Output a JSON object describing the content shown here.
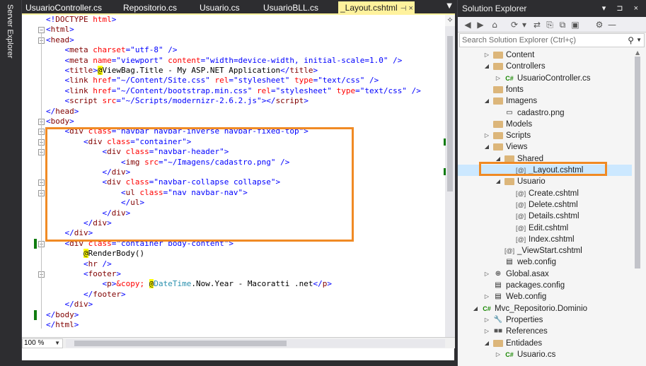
{
  "left_panel": {
    "server_explorer_label": "Server Explorer"
  },
  "editor": {
    "tabs": [
      {
        "label": "UsuarioController.cs",
        "active": false
      },
      {
        "label": "Repositorio.cs",
        "active": false
      },
      {
        "label": "Usuario.cs",
        "active": false
      },
      {
        "label": "UsuarioBLL.cs",
        "active": false
      },
      {
        "label": "_Layout.cshtml",
        "active": true
      }
    ],
    "pin_glyph": "⊣",
    "close_glyph": "×",
    "overflow_glyph": "▼",
    "split_glyph": "⟡",
    "zoom": "100 %",
    "zoom_dd_glyph": "▼"
  },
  "code_lines": [
    [
      [
        "t-br",
        "<!"
      ],
      [
        "t-tag",
        "DOCTYPE"
      ],
      [
        "t-br",
        " "
      ],
      [
        "t-attr",
        "html"
      ],
      [
        "t-br",
        ">"
      ]
    ],
    [
      [
        "t-br",
        "<"
      ],
      [
        "t-tag",
        "html"
      ],
      [
        "t-br",
        ">"
      ]
    ],
    [
      [
        "t-br",
        "<"
      ],
      [
        "t-tag",
        "head"
      ],
      [
        "t-br",
        ">"
      ]
    ],
    [
      [
        "t-txt",
        "    "
      ],
      [
        "t-br",
        "<"
      ],
      [
        "t-tag",
        "meta"
      ],
      [
        "t-br",
        " "
      ],
      [
        "t-attr",
        "charset"
      ],
      [
        "t-br",
        "="
      ],
      [
        "t-val",
        "\"utf-8\""
      ],
      [
        "t-br",
        " />"
      ]
    ],
    [
      [
        "t-txt",
        "    "
      ],
      [
        "t-br",
        "<"
      ],
      [
        "t-tag",
        "meta"
      ],
      [
        "t-br",
        " "
      ],
      [
        "t-attr",
        "name"
      ],
      [
        "t-br",
        "="
      ],
      [
        "t-val",
        "\"viewport\""
      ],
      [
        "t-br",
        " "
      ],
      [
        "t-attr",
        "content"
      ],
      [
        "t-br",
        "="
      ],
      [
        "t-val",
        "\"width=device-width, initial-scale=1.0\""
      ],
      [
        "t-br",
        " />"
      ]
    ],
    [
      [
        "t-txt",
        "    "
      ],
      [
        "t-br",
        "<"
      ],
      [
        "t-tag",
        "title"
      ],
      [
        "t-br",
        ">"
      ],
      [
        "t-razor",
        "@"
      ],
      [
        "t-txt",
        "ViewBag.Title - My ASP.NET Application"
      ],
      [
        "t-br",
        "</"
      ],
      [
        "t-tag",
        "title"
      ],
      [
        "t-br",
        ">"
      ]
    ],
    [
      [
        "t-txt",
        "    "
      ],
      [
        "t-br",
        "<"
      ],
      [
        "t-tag",
        "link"
      ],
      [
        "t-br",
        " "
      ],
      [
        "t-attr",
        "href"
      ],
      [
        "t-br",
        "="
      ],
      [
        "t-val",
        "\"~/Content/Site.css\""
      ],
      [
        "t-br",
        " "
      ],
      [
        "t-attr",
        "rel"
      ],
      [
        "t-br",
        "="
      ],
      [
        "t-val",
        "\"stylesheet\""
      ],
      [
        "t-br",
        " "
      ],
      [
        "t-attr",
        "type"
      ],
      [
        "t-br",
        "="
      ],
      [
        "t-val",
        "\"text/css\""
      ],
      [
        "t-br",
        " />"
      ]
    ],
    [
      [
        "t-txt",
        "    "
      ],
      [
        "t-br",
        "<"
      ],
      [
        "t-tag",
        "link"
      ],
      [
        "t-br",
        " "
      ],
      [
        "t-attr",
        "href"
      ],
      [
        "t-br",
        "="
      ],
      [
        "t-val",
        "\"~/Content/bootstrap.min.css\""
      ],
      [
        "t-br",
        " "
      ],
      [
        "t-attr",
        "rel"
      ],
      [
        "t-br",
        "="
      ],
      [
        "t-val",
        "\"stylesheet\""
      ],
      [
        "t-br",
        " "
      ],
      [
        "t-attr",
        "type"
      ],
      [
        "t-br",
        "="
      ],
      [
        "t-val",
        "\"text/css\""
      ],
      [
        "t-br",
        " />"
      ]
    ],
    [
      [
        "t-txt",
        "    "
      ],
      [
        "t-br",
        "<"
      ],
      [
        "t-tag",
        "script"
      ],
      [
        "t-br",
        " "
      ],
      [
        "t-attr",
        "src"
      ],
      [
        "t-br",
        "="
      ],
      [
        "t-val",
        "\"~/Scripts/modernizr-2.6.2.js\""
      ],
      [
        "t-br",
        "></"
      ],
      [
        "t-tag",
        "script"
      ],
      [
        "t-br",
        ">"
      ]
    ],
    [
      [
        "t-br",
        "</"
      ],
      [
        "t-tag",
        "head"
      ],
      [
        "t-br",
        ">"
      ]
    ],
    [
      [
        "t-br",
        "<"
      ],
      [
        "t-tag",
        "body"
      ],
      [
        "t-br",
        ">"
      ]
    ],
    [
      [
        "t-txt",
        "    "
      ],
      [
        "t-br",
        "<"
      ],
      [
        "t-tag",
        "div"
      ],
      [
        "t-br",
        " "
      ],
      [
        "t-attr",
        "class"
      ],
      [
        "t-br",
        "="
      ],
      [
        "t-val",
        "\"navbar navbar-inverse navbar-fixed-top\""
      ],
      [
        "t-br",
        ">"
      ]
    ],
    [
      [
        "t-txt",
        "        "
      ],
      [
        "t-br",
        "<"
      ],
      [
        "t-tag",
        "div"
      ],
      [
        "t-br",
        " "
      ],
      [
        "t-attr",
        "class"
      ],
      [
        "t-br",
        "="
      ],
      [
        "t-val",
        "\"container\""
      ],
      [
        "t-br",
        ">"
      ]
    ],
    [
      [
        "t-txt",
        "            "
      ],
      [
        "t-br",
        "<"
      ],
      [
        "t-tag",
        "div"
      ],
      [
        "t-br",
        " "
      ],
      [
        "t-attr",
        "class"
      ],
      [
        "t-br",
        "="
      ],
      [
        "t-val",
        "\"navbar-header\""
      ],
      [
        "t-br",
        ">"
      ]
    ],
    [
      [
        "t-txt",
        "                "
      ],
      [
        "t-br",
        "<"
      ],
      [
        "t-tag",
        "img"
      ],
      [
        "t-br",
        " "
      ],
      [
        "t-attr",
        "src"
      ],
      [
        "t-br",
        "="
      ],
      [
        "t-val",
        "\"~/Imagens/cadastro.png\""
      ],
      [
        "t-br",
        " />"
      ]
    ],
    [
      [
        "t-txt",
        "            "
      ],
      [
        "t-br",
        "</"
      ],
      [
        "t-tag",
        "div"
      ],
      [
        "t-br",
        ">"
      ]
    ],
    [
      [
        "t-txt",
        "            "
      ],
      [
        "t-br",
        "<"
      ],
      [
        "t-tag",
        "div"
      ],
      [
        "t-br",
        " "
      ],
      [
        "t-attr",
        "class"
      ],
      [
        "t-br",
        "="
      ],
      [
        "t-val",
        "\"navbar-collapse collapse\""
      ],
      [
        "t-br",
        ">"
      ]
    ],
    [
      [
        "t-txt",
        "                "
      ],
      [
        "t-br",
        "<"
      ],
      [
        "t-tag",
        "ul"
      ],
      [
        "t-br",
        " "
      ],
      [
        "t-attr",
        "class"
      ],
      [
        "t-br",
        "="
      ],
      [
        "t-val",
        "\"nav navbar-nav\""
      ],
      [
        "t-br",
        ">"
      ]
    ],
    [
      [
        "t-txt",
        "                "
      ],
      [
        "t-br",
        "</"
      ],
      [
        "t-tag",
        "ul"
      ],
      [
        "t-br",
        ">"
      ]
    ],
    [
      [
        "t-txt",
        "            "
      ],
      [
        "t-br",
        "</"
      ],
      [
        "t-tag",
        "div"
      ],
      [
        "t-br",
        ">"
      ]
    ],
    [
      [
        "t-txt",
        "        "
      ],
      [
        "t-br",
        "</"
      ],
      [
        "t-tag",
        "div"
      ],
      [
        "t-br",
        ">"
      ]
    ],
    [
      [
        "t-txt",
        "    "
      ],
      [
        "t-br",
        "</"
      ],
      [
        "t-tag",
        "div"
      ],
      [
        "t-br",
        ">"
      ]
    ],
    [
      [
        "t-txt",
        "    "
      ],
      [
        "t-br",
        "<"
      ],
      [
        "t-tag",
        "div"
      ],
      [
        "t-br",
        " "
      ],
      [
        "t-attr",
        "class"
      ],
      [
        "t-br",
        "="
      ],
      [
        "t-val",
        "\"container body-content\""
      ],
      [
        "t-br",
        ">"
      ]
    ],
    [
      [
        "t-txt",
        "        "
      ],
      [
        "t-razor",
        "@"
      ],
      [
        "t-txt",
        "RenderBody()"
      ]
    ],
    [
      [
        "t-txt",
        "        "
      ],
      [
        "t-br",
        "<"
      ],
      [
        "t-tag",
        "hr"
      ],
      [
        "t-br",
        " />"
      ]
    ],
    [
      [
        "t-txt",
        "        "
      ],
      [
        "t-br",
        "<"
      ],
      [
        "t-tag",
        "footer"
      ],
      [
        "t-br",
        ">"
      ]
    ],
    [
      [
        "t-txt",
        "            "
      ],
      [
        "t-br",
        "<"
      ],
      [
        "t-tag",
        "p"
      ],
      [
        "t-br",
        ">"
      ],
      [
        "t-attr",
        "&copy;"
      ],
      [
        "t-txt",
        " "
      ],
      [
        "t-razor",
        "@"
      ],
      [
        "t-type",
        "DateTime"
      ],
      [
        "t-txt",
        ".Now.Year - Macoratti .net"
      ],
      [
        "t-br",
        "</"
      ],
      [
        "t-tag",
        "p"
      ],
      [
        "t-br",
        ">"
      ]
    ],
    [
      [
        "t-txt",
        "        "
      ],
      [
        "t-br",
        "</"
      ],
      [
        "t-tag",
        "footer"
      ],
      [
        "t-br",
        ">"
      ]
    ],
    [
      [
        "t-txt",
        "    "
      ],
      [
        "t-br",
        "</"
      ],
      [
        "t-tag",
        "div"
      ],
      [
        "t-br",
        ">"
      ]
    ],
    [
      [
        "t-br",
        "</"
      ],
      [
        "t-tag",
        "body"
      ],
      [
        "t-br",
        ">"
      ]
    ],
    [
      [
        "t-br",
        "</"
      ],
      [
        "t-tag",
        "html"
      ],
      [
        "t-br",
        ">"
      ]
    ]
  ],
  "solution_explorer": {
    "title": "Solution Explorer",
    "title_icons": "▾ ⊐ ×",
    "toolbar_icons": [
      "◀",
      "▶",
      "⌂",
      "⟳",
      "▾",
      "⇄",
      "⎘",
      "⧉",
      "▣",
      "⚙",
      "—"
    ],
    "search_placeholder": "Search Solution Explorer (Ctrl+ç)",
    "search_icon": "⚲",
    "search_dd": "▼",
    "tree": [
      {
        "label": "Content",
        "indent": 2,
        "arrow": "▷",
        "icon": "folder"
      },
      {
        "label": "Controllers",
        "indent": 2,
        "arrow": "◢",
        "icon": "folder"
      },
      {
        "label": "UsuarioController.cs",
        "indent": 3,
        "arrow": "▷",
        "icon": "cs"
      },
      {
        "label": "fonts",
        "indent": 2,
        "arrow": "",
        "icon": "folder"
      },
      {
        "label": "Imagens",
        "indent": 2,
        "arrow": "◢",
        "icon": "folder"
      },
      {
        "label": "cadastro.png",
        "indent": 3,
        "arrow": "",
        "icon": "img"
      },
      {
        "label": "Models",
        "indent": 2,
        "arrow": "",
        "icon": "folder"
      },
      {
        "label": "Scripts",
        "indent": 2,
        "arrow": "▷",
        "icon": "folder"
      },
      {
        "label": "Views",
        "indent": 2,
        "arrow": "◢",
        "icon": "folder"
      },
      {
        "label": "Shared",
        "indent": 3,
        "arrow": "◢",
        "icon": "folder"
      },
      {
        "label": "_Layout.cshtml",
        "indent": 4,
        "arrow": "",
        "icon": "cshtml",
        "selected": true
      },
      {
        "label": "Usuario",
        "indent": 3,
        "arrow": "◢",
        "icon": "folder"
      },
      {
        "label": "Create.cshtml",
        "indent": 4,
        "arrow": "",
        "icon": "cshtml"
      },
      {
        "label": "Delete.cshtml",
        "indent": 4,
        "arrow": "",
        "icon": "cshtml"
      },
      {
        "label": "Details.cshtml",
        "indent": 4,
        "arrow": "",
        "icon": "cshtml"
      },
      {
        "label": "Edit.cshtml",
        "indent": 4,
        "arrow": "",
        "icon": "cshtml"
      },
      {
        "label": "Index.cshtml",
        "indent": 4,
        "arrow": "",
        "icon": "cshtml"
      },
      {
        "label": "_ViewStart.cshtml",
        "indent": 3,
        "arrow": "",
        "icon": "cshtml"
      },
      {
        "label": "web.config",
        "indent": 3,
        "arrow": "",
        "icon": "config"
      },
      {
        "label": "Global.asax",
        "indent": 2,
        "arrow": "▷",
        "icon": "asax"
      },
      {
        "label": "packages.config",
        "indent": 2,
        "arrow": "",
        "icon": "config"
      },
      {
        "label": "Web.config",
        "indent": 2,
        "arrow": "▷",
        "icon": "config"
      },
      {
        "label": "Mvc_Repositorio.Dominio",
        "indent": 1,
        "arrow": "◢",
        "icon": "proj"
      },
      {
        "label": "Properties",
        "indent": 2,
        "arrow": "▷",
        "icon": "wrench"
      },
      {
        "label": "References",
        "indent": 2,
        "arrow": "▷",
        "icon": "ref"
      },
      {
        "label": "Entidades",
        "indent": 2,
        "arrow": "◢",
        "icon": "folder"
      },
      {
        "label": "Usuario.cs",
        "indent": 3,
        "arrow": "▷",
        "icon": "cs"
      }
    ],
    "icon_glyphs": {
      "cs": "C#",
      "cshtml": "[@]",
      "img": "▭",
      "config": "▤",
      "asax": "⊕",
      "proj": "C#",
      "wrench": "🔧",
      "ref": "■■"
    }
  }
}
